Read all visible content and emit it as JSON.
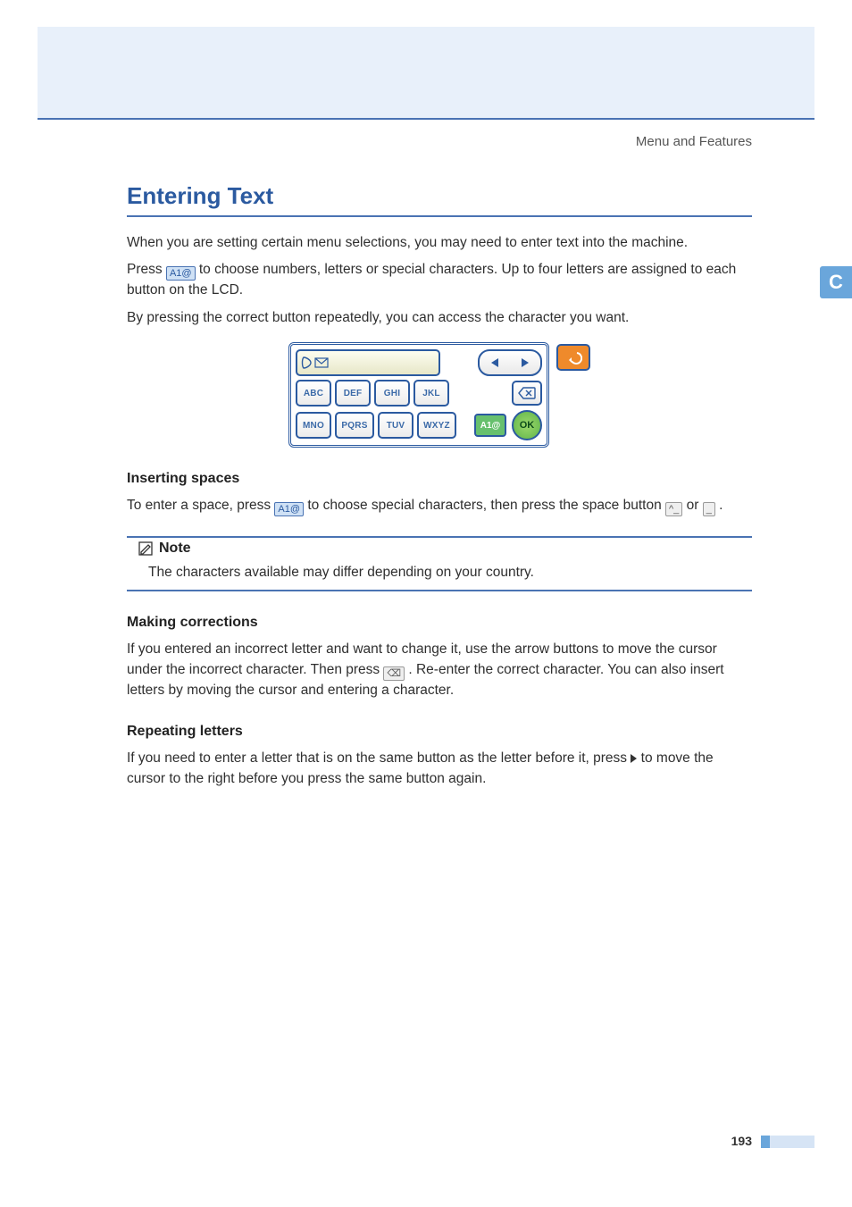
{
  "header": {
    "breadcrumb": "Menu and Features"
  },
  "side_tab": {
    "letter": "C"
  },
  "h1": {
    "title": "Entering Text"
  },
  "intro": {
    "p1": "When you are setting certain menu selections, you may need to enter text into the machine.",
    "p2a": "Press ",
    "p2b": " to choose numbers, letters or special characters. Up to four letters are assigned to each button on the LCD.",
    "p3": "By pressing the correct button repeatedly, you can access the character you want."
  },
  "keypad": {
    "row1": [
      "ABC",
      "DEF",
      "GHI",
      "JKL"
    ],
    "row2": [
      "MNO",
      "PQRS",
      "TUV",
      "WXYZ"
    ],
    "mode_label": "A1@",
    "ok_label": "OK"
  },
  "inserting_spaces": {
    "heading": "Inserting spaces",
    "p_a": "To enter a space, press ",
    "p_b": " to choose special characters, then press the space button ",
    "p_c": " or ",
    "p_d": "."
  },
  "note": {
    "label": "Note",
    "body": "The characters available may differ depending on your country."
  },
  "making_corrections": {
    "heading": "Making corrections",
    "p_a": "If you entered an incorrect letter and want to change it, use the arrow buttons to move the cursor under the incorrect character. Then press ",
    "p_b": ". Re-enter the correct character. You can also insert letters by moving the cursor and entering a character."
  },
  "repeating_letters": {
    "heading": "Repeating letters",
    "p_a": "If you need to enter a letter that is on the same button as the letter before it, press ",
    "p_b": " to move the cursor to the right before you press the same button again."
  },
  "icons": {
    "a1_small": "A1@",
    "space1": "^_",
    "space2": "_",
    "bksp_small": "⌫"
  },
  "footer": {
    "page": "193"
  }
}
